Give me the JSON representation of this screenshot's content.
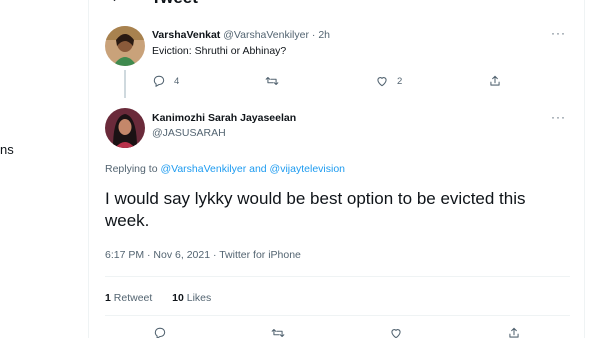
{
  "left_fragment": "ns",
  "header": {
    "title": "Tweet"
  },
  "parent_tweet": {
    "name": "VarshaVenkat",
    "handle": "@VarshaVenkilyer",
    "time": "· 2h",
    "text": "Eviction: Shruthi or Abhinay?",
    "reply_count": "4",
    "retweet_count": "",
    "like_count": "2",
    "icons": [
      "reply-icon",
      "retweet-icon",
      "like-icon",
      "share-icon"
    ]
  },
  "main_tweet": {
    "name": "Kanimozhi Sarah Jayaseelan",
    "handle": "@JASUSARAH",
    "replying_prefix": "Replying to",
    "replying_to": "@VarshaVenkilyer and @vijaytelevision",
    "text": "I would say lykky would be best option to be evicted this week.",
    "timestamp": "6:17 PM · Nov 6, 2021 · Twitter for iPhone",
    "retweets_count": "1",
    "retweets_label": "Retweet",
    "likes_count": "10",
    "likes_label": "Likes"
  },
  "colors": {
    "accent": "#1d9bf0",
    "text": "#0f1419",
    "muted": "#536471",
    "border": "#eff3f4"
  }
}
